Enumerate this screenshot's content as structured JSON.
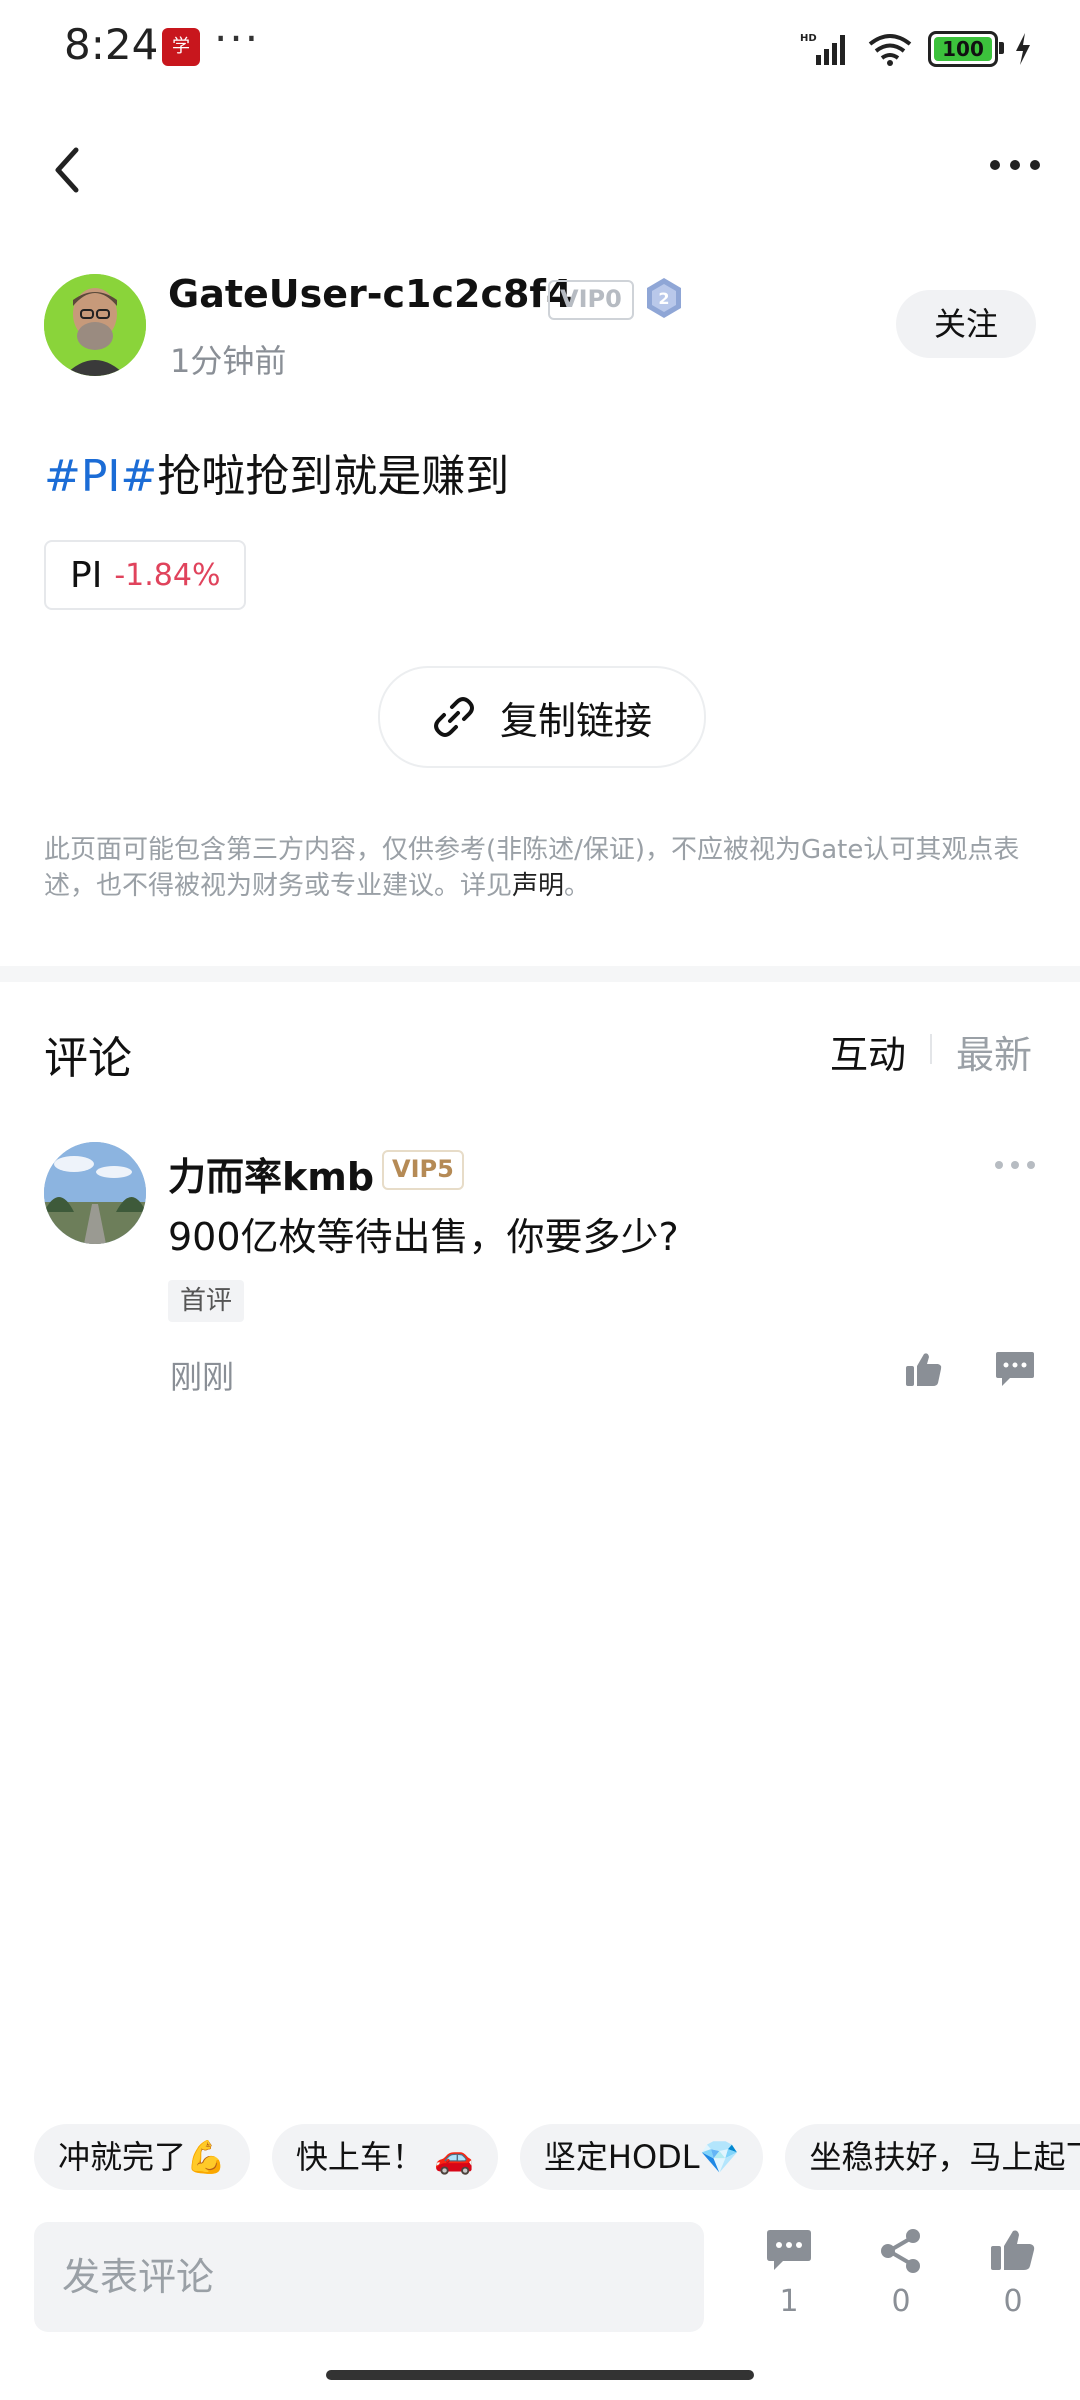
{
  "status_bar": {
    "time": "8:24",
    "dots": "···",
    "battery": "100",
    "app_badge_icon": "xuexi-app-icon"
  },
  "nav": {
    "back_icon": "back-chevron-icon",
    "more_icon": "more-horizontal-icon"
  },
  "post": {
    "author": "GateUser-c1c2c8f4",
    "vip": "VIP0",
    "level": "2",
    "time": "1分钟前",
    "follow_label": "关注",
    "hashtag": "#PI#",
    "text": "抢啦抢到就是赚到",
    "ticker": {
      "name": "PI",
      "change": "-1.84%"
    },
    "copy_link_label": "复制链接",
    "disclaimer_text": "此页面可能包含第三方内容，仅供参考(非陈述/保证)，不应被视为Gate认可其观点表述，也不得被视为财务或专业建议。详见",
    "disclaimer_link": "声明",
    "disclaimer_end": "。"
  },
  "comments": {
    "title": "评论",
    "tab_interact": "互动",
    "tab_latest": "最新",
    "items": [
      {
        "author": "力而率kmb",
        "vip": "VIP5",
        "text": "900亿枚等待出售，你要多少?",
        "tag": "首评",
        "time": "刚刚"
      }
    ]
  },
  "quick_replies": [
    "冲就完了💪",
    "快上车！ 🚗",
    "坚定HODL💎",
    "坐稳扶好，马上起飞"
  ],
  "bottom_bar": {
    "placeholder": "发表评论",
    "comment_count": "1",
    "share_count": "0",
    "like_count": "0"
  },
  "colors": {
    "hashtag": "#1b6cd6",
    "negative": "#e0435c",
    "muted": "#9aa0a6",
    "chip_bg": "#f2f3f5"
  }
}
